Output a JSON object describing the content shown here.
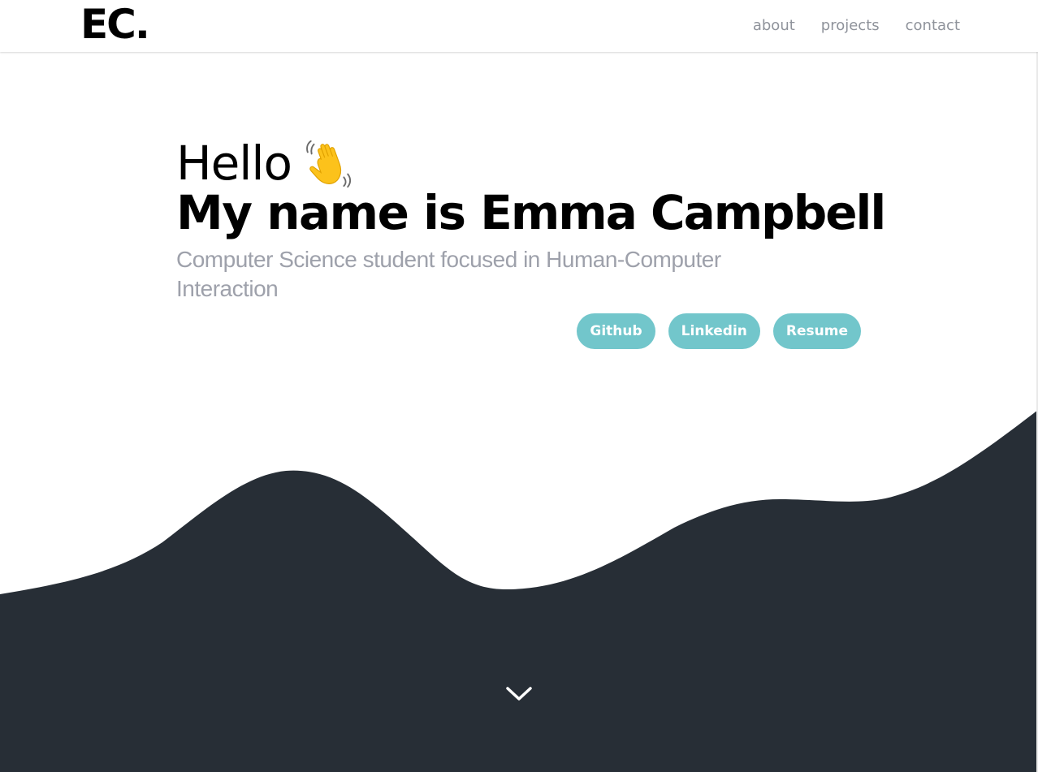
{
  "brand": {
    "logo": "EC."
  },
  "nav": {
    "items": [
      "about",
      "projects",
      "contact"
    ]
  },
  "hero": {
    "greeting": "Hello",
    "intro": "My name is",
    "name": "Emma Campbell",
    "subtitle": "Computer Science student focused in Human-Computer Interaction",
    "greeting_icon": "waving-hand-icon"
  },
  "links": {
    "github": "Github",
    "linkedin": "Linkedin",
    "resume": "Resume"
  },
  "scroll": {
    "icon": "chevron-down-icon"
  },
  "colors": {
    "accent": "#72c6cb",
    "dark": "#272e36",
    "muted_text": "#9ea1ab",
    "nav_text": "#8f939b"
  }
}
